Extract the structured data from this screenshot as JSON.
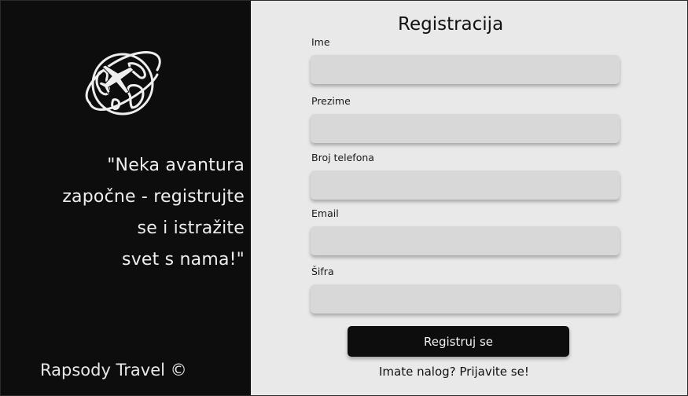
{
  "branding": {
    "logo_icon": "globe-airplane-icon",
    "tagline_lines": [
      "\"Neka avantura",
      "započne - registrujte",
      "se i istražite",
      "svet s nama!\""
    ],
    "brand_name": "Rapsody Travel ©"
  },
  "form": {
    "title": "Registracija",
    "fields": [
      {
        "label": "Ime",
        "value": ""
      },
      {
        "label": "Prezime",
        "value": ""
      },
      {
        "label": "Broj telefona",
        "value": ""
      },
      {
        "label": "Email",
        "value": ""
      },
      {
        "label": "Šifra",
        "value": ""
      }
    ],
    "submit_label": "Registruj se",
    "login_prompt": "Imate nalog? Prijavite se!"
  },
  "colors": {
    "left_panel": "#0d0d0d",
    "right_panel": "#e9e9e9",
    "input_background": "#d8d8d8",
    "button_background": "#0d0d0d"
  }
}
